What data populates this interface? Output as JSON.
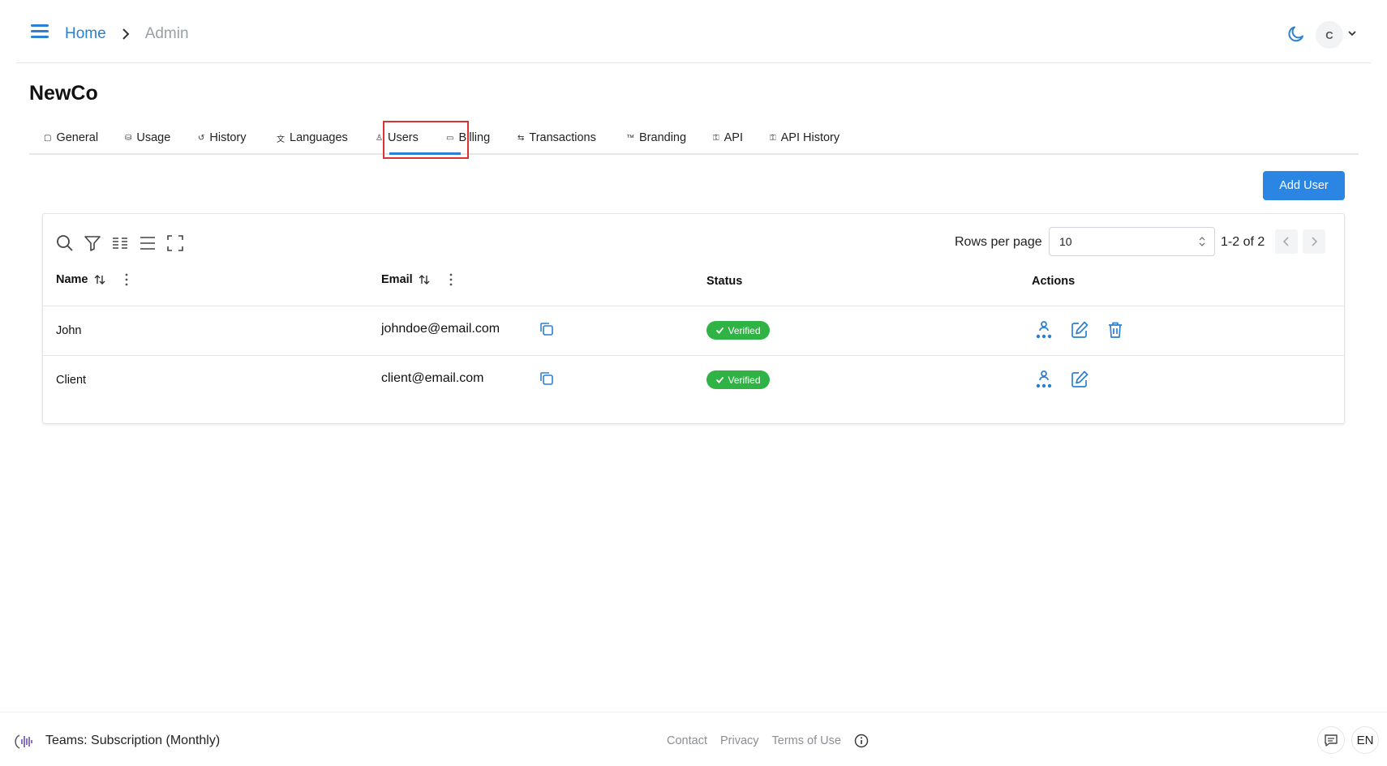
{
  "header": {
    "breadcrumb": {
      "home": "Home",
      "current": "Admin"
    },
    "avatar_initial": "C"
  },
  "page": {
    "title": "NewCo"
  },
  "tabs": [
    {
      "label": "General",
      "icon": "square-info-icon"
    },
    {
      "label": "Usage",
      "icon": "bucket-icon"
    },
    {
      "label": "History",
      "icon": "history-icon"
    },
    {
      "label": "Languages",
      "icon": "translate-icon"
    },
    {
      "label": "Users",
      "icon": "user-icon",
      "active": true
    },
    {
      "label": "Billing",
      "icon": "credit-card-icon"
    },
    {
      "label": "Transactions",
      "icon": "arrows-icon"
    },
    {
      "label": "Branding",
      "icon": "trademark-icon"
    },
    {
      "label": "API",
      "icon": "api-icon"
    },
    {
      "label": "API History",
      "icon": "api-icon"
    }
  ],
  "actions": {
    "add_user": "Add User"
  },
  "table": {
    "rows_per_page_label": "Rows per page",
    "rows_per_page_value": "10",
    "range": "1-2 of 2",
    "columns": {
      "name": "Name",
      "email": "Email",
      "status": "Status",
      "actions": "Actions"
    },
    "rows": [
      {
        "name": "John",
        "email": "johndoe@email.com",
        "status": "Verified",
        "can_delete": true
      },
      {
        "name": "Client",
        "email": "client@email.com",
        "status": "Verified",
        "can_delete": false
      }
    ]
  },
  "footer": {
    "plan": "Teams: Subscription (Monthly)",
    "links": [
      "Contact",
      "Privacy",
      "Terms of Use"
    ],
    "language": "EN"
  },
  "colors": {
    "accent": "#2b7fd4",
    "button": "#2b86e3",
    "verified": "#2fb344",
    "highlight": "#e03131"
  }
}
